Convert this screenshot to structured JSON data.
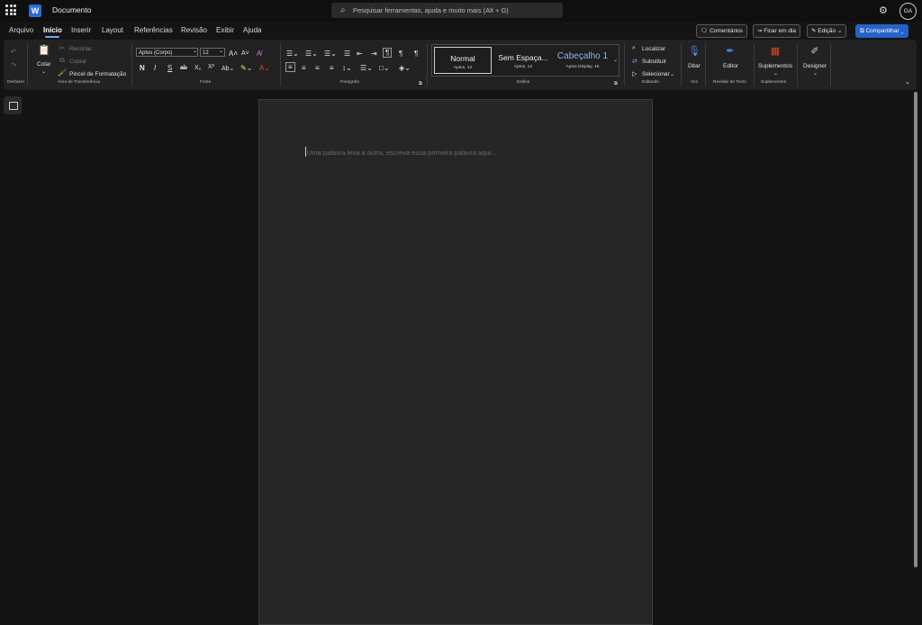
{
  "app": {
    "title": "Documento",
    "logo_letter": "W",
    "search_placeholder": "Pesquisar ferramentas, ajuda e muito mais (Alt + G)",
    "user_initials": "GA"
  },
  "tabs": [
    "Arquivo",
    "Início",
    "Inserir",
    "Layout",
    "Referências",
    "Revisão",
    "Exibir",
    "Ajuda"
  ],
  "active_tab": "Início",
  "actions": {
    "comments": "Comentários",
    "catch_up": "Ficar em dia",
    "editing": "Edição",
    "share": "Compartilhar"
  },
  "ribbon": {
    "undo_group": "Desfazer",
    "clipboard": {
      "label": "Área de Transferência",
      "paste": "Colar",
      "cut": "Recortar",
      "copy": "Copiar",
      "format_painter": "Pincel de Formatação"
    },
    "font": {
      "label": "Fonte",
      "family": "Aptos (Corpo)",
      "size": "12",
      "bold": "N",
      "italic": "I",
      "underline": "S"
    },
    "paragraph": {
      "label": "Parágrafo"
    },
    "styles": {
      "label": "Estilos",
      "items": [
        {
          "name": "Normal",
          "sub": "Aptos, 12"
        },
        {
          "name": "Sem Espaça...",
          "sub": "Aptos, 12"
        },
        {
          "name": "Cabeçalho 1",
          "sub": "Aptos Display, 16"
        }
      ]
    },
    "editing": {
      "label": "Editando",
      "find": "Localizar",
      "replace": "Substituir",
      "select": "Selecionar"
    },
    "voice": {
      "label": "Voz",
      "dictate": "Ditar"
    },
    "proofing": {
      "label": "Revisão de Texto",
      "editor": "Editor"
    },
    "addins": {
      "label": "Suplementos",
      "button": "Suplementos"
    },
    "designer": {
      "button": "Designer"
    }
  },
  "document": {
    "placeholder": "Uma palavra leva a outra, escreva essa primeira palavra aqui..."
  },
  "colors": {
    "accent": "#2563c9",
    "tab_underline": "#6aa7ff",
    "heading_style": "#8fb4e8",
    "font_color_red": "#e0463a",
    "highlight_yellow": "#f2e14c",
    "addins_red": "#d9482f",
    "designer_blue": "#4b8ff0"
  }
}
